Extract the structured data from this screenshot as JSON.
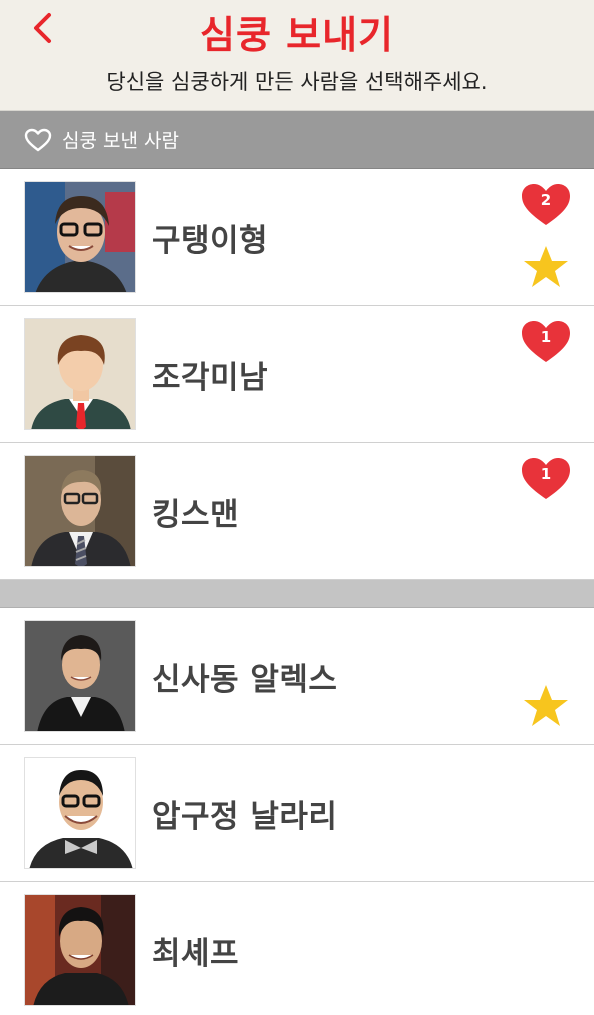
{
  "header": {
    "title": "심쿵 보내기",
    "subtitle": "당신을 심쿵하게 만든 사람을 선택해주세요."
  },
  "section": {
    "label": "심쿵 보낸 사람"
  },
  "sent_list": [
    {
      "name": "구탱이형",
      "hearts": "2",
      "starred": true
    },
    {
      "name": "조각미남",
      "hearts": "1",
      "starred": false
    },
    {
      "name": "킹스맨",
      "hearts": "1",
      "starred": false
    }
  ],
  "other_list": [
    {
      "name": "신사동 알렉스",
      "starred": true
    },
    {
      "name": "압구정 날라리",
      "starred": false
    },
    {
      "name": "최셰프",
      "starred": false
    }
  ],
  "colors": {
    "accent": "#e8262b",
    "heart": "#e8333a",
    "star": "#f7c51e",
    "section_bar": "#9a9a9a"
  }
}
